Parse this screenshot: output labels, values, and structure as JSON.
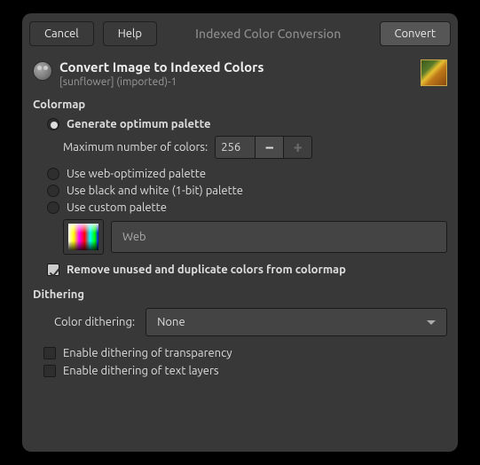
{
  "titlebar": {
    "cancel": "Cancel",
    "help": "Help",
    "title": "Indexed Color Conversion",
    "convert": "Convert"
  },
  "header": {
    "title": "Convert Image to Indexed Colors",
    "subtitle": "[sunflower] (imported)-1"
  },
  "colormap": {
    "section": "Colormap",
    "opt_generate": "Generate optimum palette",
    "max_colors_label": "Maximum number of colors:",
    "max_colors_value": "256",
    "opt_web": "Use web-optimized palette",
    "opt_bw": "Use black and white (1-bit) palette",
    "opt_custom": "Use custom palette",
    "palette_name": "Web",
    "remove_unused": "Remove unused and duplicate colors from colormap"
  },
  "dithering": {
    "section": "Dithering",
    "color_label": "Color dithering:",
    "color_value": "None",
    "transparency": "Enable dithering of transparency",
    "text_layers": "Enable dithering of text layers"
  }
}
